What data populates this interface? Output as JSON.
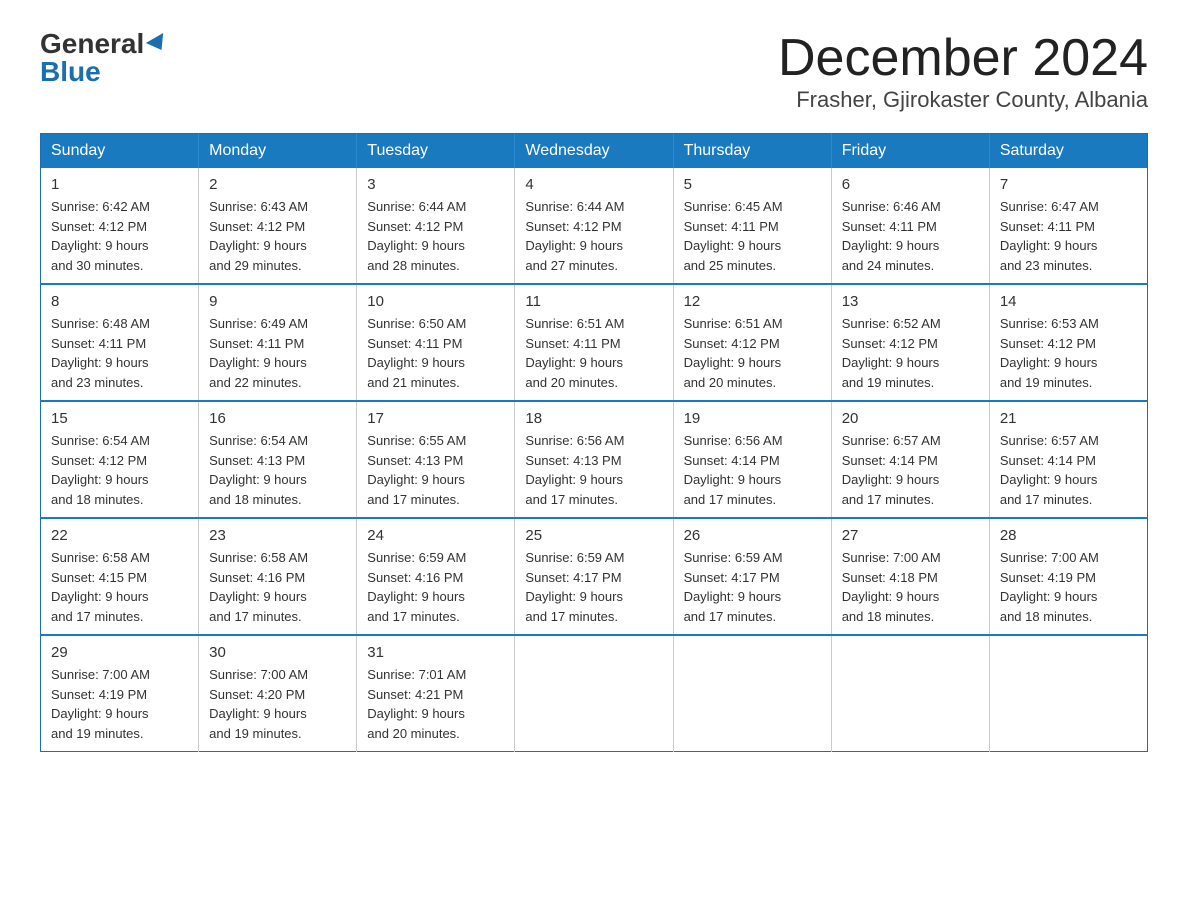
{
  "logo": {
    "general": "General",
    "blue": "Blue"
  },
  "header": {
    "month": "December 2024",
    "location": "Frasher, Gjirokaster County, Albania"
  },
  "weekdays": [
    "Sunday",
    "Monday",
    "Tuesday",
    "Wednesday",
    "Thursday",
    "Friday",
    "Saturday"
  ],
  "weeks": [
    [
      {
        "day": "1",
        "sunrise": "6:42 AM",
        "sunset": "4:12 PM",
        "daylight": "9 hours and 30 minutes."
      },
      {
        "day": "2",
        "sunrise": "6:43 AM",
        "sunset": "4:12 PM",
        "daylight": "9 hours and 29 minutes."
      },
      {
        "day": "3",
        "sunrise": "6:44 AM",
        "sunset": "4:12 PM",
        "daylight": "9 hours and 28 minutes."
      },
      {
        "day": "4",
        "sunrise": "6:44 AM",
        "sunset": "4:12 PM",
        "daylight": "9 hours and 27 minutes."
      },
      {
        "day": "5",
        "sunrise": "6:45 AM",
        "sunset": "4:11 PM",
        "daylight": "9 hours and 25 minutes."
      },
      {
        "day": "6",
        "sunrise": "6:46 AM",
        "sunset": "4:11 PM",
        "daylight": "9 hours and 24 minutes."
      },
      {
        "day": "7",
        "sunrise": "6:47 AM",
        "sunset": "4:11 PM",
        "daylight": "9 hours and 23 minutes."
      }
    ],
    [
      {
        "day": "8",
        "sunrise": "6:48 AM",
        "sunset": "4:11 PM",
        "daylight": "9 hours and 23 minutes."
      },
      {
        "day": "9",
        "sunrise": "6:49 AM",
        "sunset": "4:11 PM",
        "daylight": "9 hours and 22 minutes."
      },
      {
        "day": "10",
        "sunrise": "6:50 AM",
        "sunset": "4:11 PM",
        "daylight": "9 hours and 21 minutes."
      },
      {
        "day": "11",
        "sunrise": "6:51 AM",
        "sunset": "4:11 PM",
        "daylight": "9 hours and 20 minutes."
      },
      {
        "day": "12",
        "sunrise": "6:51 AM",
        "sunset": "4:12 PM",
        "daylight": "9 hours and 20 minutes."
      },
      {
        "day": "13",
        "sunrise": "6:52 AM",
        "sunset": "4:12 PM",
        "daylight": "9 hours and 19 minutes."
      },
      {
        "day": "14",
        "sunrise": "6:53 AM",
        "sunset": "4:12 PM",
        "daylight": "9 hours and 19 minutes."
      }
    ],
    [
      {
        "day": "15",
        "sunrise": "6:54 AM",
        "sunset": "4:12 PM",
        "daylight": "9 hours and 18 minutes."
      },
      {
        "day": "16",
        "sunrise": "6:54 AM",
        "sunset": "4:13 PM",
        "daylight": "9 hours and 18 minutes."
      },
      {
        "day": "17",
        "sunrise": "6:55 AM",
        "sunset": "4:13 PM",
        "daylight": "9 hours and 17 minutes."
      },
      {
        "day": "18",
        "sunrise": "6:56 AM",
        "sunset": "4:13 PM",
        "daylight": "9 hours and 17 minutes."
      },
      {
        "day": "19",
        "sunrise": "6:56 AM",
        "sunset": "4:14 PM",
        "daylight": "9 hours and 17 minutes."
      },
      {
        "day": "20",
        "sunrise": "6:57 AM",
        "sunset": "4:14 PM",
        "daylight": "9 hours and 17 minutes."
      },
      {
        "day": "21",
        "sunrise": "6:57 AM",
        "sunset": "4:14 PM",
        "daylight": "9 hours and 17 minutes."
      }
    ],
    [
      {
        "day": "22",
        "sunrise": "6:58 AM",
        "sunset": "4:15 PM",
        "daylight": "9 hours and 17 minutes."
      },
      {
        "day": "23",
        "sunrise": "6:58 AM",
        "sunset": "4:16 PM",
        "daylight": "9 hours and 17 minutes."
      },
      {
        "day": "24",
        "sunrise": "6:59 AM",
        "sunset": "4:16 PM",
        "daylight": "9 hours and 17 minutes."
      },
      {
        "day": "25",
        "sunrise": "6:59 AM",
        "sunset": "4:17 PM",
        "daylight": "9 hours and 17 minutes."
      },
      {
        "day": "26",
        "sunrise": "6:59 AM",
        "sunset": "4:17 PM",
        "daylight": "9 hours and 17 minutes."
      },
      {
        "day": "27",
        "sunrise": "7:00 AM",
        "sunset": "4:18 PM",
        "daylight": "9 hours and 18 minutes."
      },
      {
        "day": "28",
        "sunrise": "7:00 AM",
        "sunset": "4:19 PM",
        "daylight": "9 hours and 18 minutes."
      }
    ],
    [
      {
        "day": "29",
        "sunrise": "7:00 AM",
        "sunset": "4:19 PM",
        "daylight": "9 hours and 19 minutes."
      },
      {
        "day": "30",
        "sunrise": "7:00 AM",
        "sunset": "4:20 PM",
        "daylight": "9 hours and 19 minutes."
      },
      {
        "day": "31",
        "sunrise": "7:01 AM",
        "sunset": "4:21 PM",
        "daylight": "9 hours and 20 minutes."
      },
      null,
      null,
      null,
      null
    ]
  ],
  "labels": {
    "sunrise": "Sunrise: ",
    "sunset": "Sunset: ",
    "daylight": "Daylight: "
  }
}
